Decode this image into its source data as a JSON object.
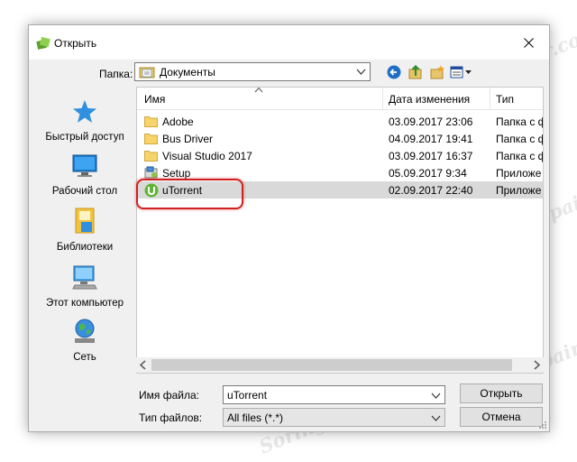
{
  "window": {
    "title": "Открыть"
  },
  "lookin": {
    "label": "Папка:",
    "value": "Документы"
  },
  "toolbar": {
    "back_icon": "back-arrow-icon",
    "up_icon": "up-folder-icon",
    "newfolder_icon": "new-folder-icon",
    "view_icon": "view-menu-icon"
  },
  "places": [
    {
      "label": "Быстрый доступ",
      "icon": "star-icon"
    },
    {
      "label": "Рабочий стол",
      "icon": "desktop-icon"
    },
    {
      "label": "Библиотеки",
      "icon": "libraries-icon"
    },
    {
      "label": "Этот компьютер",
      "icon": "computer-icon"
    },
    {
      "label": "Сеть",
      "icon": "network-icon"
    }
  ],
  "columns": {
    "name": "Имя",
    "date": "Дата изменения",
    "type": "Тип"
  },
  "files": [
    {
      "name": "Adobe",
      "date": "03.09.2017 23:06",
      "type": "Папка с ф",
      "icon": "folder-icon"
    },
    {
      "name": "Bus Driver",
      "date": "04.09.2017 19:41",
      "type": "Папка с ф",
      "icon": "folder-icon"
    },
    {
      "name": "Visual Studio 2017",
      "date": "03.09.2017 16:37",
      "type": "Папка с ф",
      "icon": "folder-icon"
    },
    {
      "name": "Setup",
      "date": "05.09.2017 9:34",
      "type": "Приложе",
      "icon": "setup-icon"
    },
    {
      "name": "uTorrent",
      "date": "02.09.2017 22:40",
      "type": "Приложе",
      "icon": "utorrent-icon",
      "selected": true
    }
  ],
  "filename": {
    "label": "Имя файла:",
    "value": "uTorrent"
  },
  "filetype": {
    "label": "Тип файлов:",
    "value": "All files (*.*)"
  },
  "buttons": {
    "open": "Открыть",
    "cancel": "Отмена"
  },
  "watermark": "Soringpcrepair.com",
  "colors": {
    "highlight_border": "#d02020",
    "selected_row": "#d9d9d9",
    "dialog_bg": "#f0f0f0"
  }
}
